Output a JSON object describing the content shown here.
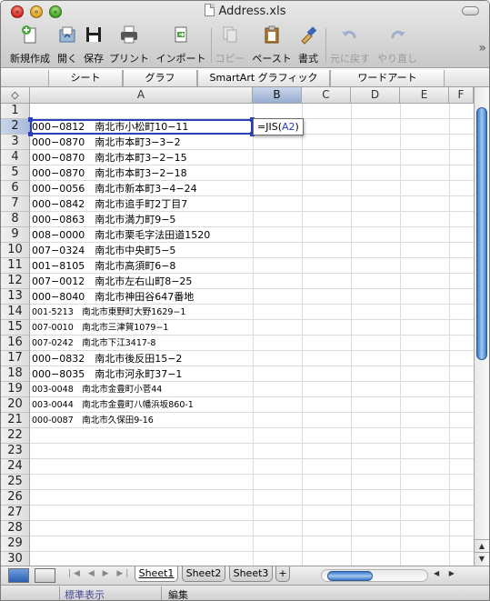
{
  "window": {
    "title": "Address.xls"
  },
  "toolbar": {
    "new": "新規作成",
    "open": "開く",
    "save": "保存",
    "print": "プリント",
    "import": "インポート",
    "copy": "コピー",
    "paste": "ペースト",
    "format": "書式",
    "undo": "元に戻す",
    "redo": "やり直し",
    "more": "»"
  },
  "ribbon_tabs": [
    "シート",
    "グラフ",
    "SmartArt グラフィック",
    "ワードアート"
  ],
  "grid": {
    "corner_icon": "select-all-icon",
    "columns": [
      "A",
      "B",
      "C",
      "D",
      "E",
      "F"
    ],
    "selected_column": "B",
    "selected_row": 2,
    "row_numbers": [
      "1",
      "2",
      "3",
      "4",
      "5",
      "6",
      "7",
      "8",
      "9",
      "10",
      "11",
      "12",
      "13",
      "14",
      "15",
      "16",
      "17",
      "18",
      "19",
      "20",
      "21",
      "22",
      "23",
      "24",
      "25",
      "26",
      "27",
      "28",
      "29",
      "30"
    ],
    "column_a": [
      "",
      "000−0812　南北市小松町10−11",
      "000−0870　南北市本町3−3−2",
      "000−0870　南北市本町3−2−15",
      "000−0870　南北市本町3−2−18",
      "000−0056　南北市新本町3−4−24",
      "000−0842　南北市追手町2丁目7",
      "000−0863　南北市満力町9−5",
      "008−0000　南北市栗毛字法田道1520",
      "007−0324　南北市中央町5−5",
      "001−8105　南北市高須町6−8",
      "007−0012　南北市左右山町8−25",
      "000−8040　南北市神田谷647番地",
      "001-5213　南北市東野町大野1629−1",
      "007-0010　南北市三津賀1079−1",
      "007-0242　南北市下江3417-8",
      "000−0832　南北市後反田15−2",
      "000−8035　南北市河永町37−1",
      "003-0048　南北市金豊町小菅44",
      "003-0044　南北市金豊町八幡浜坂860-1",
      "000-0087　南北市久保田9-16"
    ],
    "formula": {
      "prefix": "=JIS(",
      "ref": "A2",
      "suffix": ")"
    }
  },
  "sheets": [
    "Sheet1",
    "Sheet2",
    "Sheet3"
  ],
  "add_sheet": "+",
  "status": {
    "view_mode": "標準表示",
    "mode": "編集"
  },
  "colors": {
    "accent": "#2b3fbf",
    "scroll_thumb": "#3a78c9"
  }
}
